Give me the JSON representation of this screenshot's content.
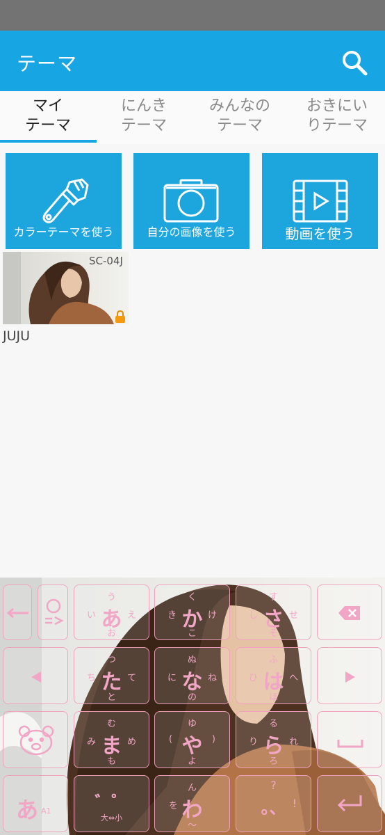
{
  "app_bar": {
    "title": "テーマ"
  },
  "tabs": [
    {
      "line1": "マイ",
      "line2": "テーマ",
      "active": true
    },
    {
      "line1": "にんき",
      "line2": "テーマ",
      "active": false
    },
    {
      "line1": "みんなの",
      "line2": "テーマ",
      "active": false
    },
    {
      "line1": "おきにい",
      "line2": "りテーマ",
      "active": false
    }
  ],
  "tiles": {
    "color_theme": "カラーテーマを使う",
    "own_image": "自分の画像を使う",
    "video": "動画を使う"
  },
  "theme_item": {
    "device": "SC-04J",
    "name": "JUJU"
  },
  "keyboard": {
    "row1": {
      "a": {
        "main": "あ",
        "up": "う",
        "left": "い",
        "right": "え",
        "down": "お"
      },
      "ka": {
        "main": "か",
        "up": "く",
        "left": "き",
        "right": "け",
        "down": "こ"
      },
      "sa": {
        "main": "さ",
        "up": "す",
        "left": "し",
        "right": "せ",
        "down": "そ"
      }
    },
    "row2": {
      "ta": {
        "main": "た",
        "up": "つ",
        "left": "ち",
        "right": "て",
        "down": "と"
      },
      "na": {
        "main": "な",
        "up": "ぬ",
        "left": "に",
        "right": "ね",
        "down": "の"
      },
      "ha": {
        "main": "は",
        "up": "ふ",
        "left": "ひ",
        "right": "へ",
        "down": "ほ"
      }
    },
    "row3": {
      "ma": {
        "main": "ま",
        "up": "む",
        "left": "み",
        "right": "め",
        "down": "も"
      },
      "ya": {
        "main": "や",
        "up": "ゆ",
        "left": "(",
        "right": ")",
        "down": "よ"
      },
      "ra": {
        "main": "ら",
        "up": "る",
        "left": "り",
        "right": "れ",
        "down": "ろ"
      }
    },
    "row4": {
      "mode": {
        "main": "あ",
        "sub": "A1"
      },
      "dakuten": {
        "main": "゛゜",
        "sub": "大⇔小"
      },
      "wa": {
        "main": "わ",
        "up": "ん",
        "left": "を",
        "down": "〜"
      },
      "punct": {
        "main": "。、",
        "up": "?",
        "right": "!"
      }
    },
    "enter": "↵",
    "space": "␣"
  },
  "colors": {
    "accent": "#17a5e3",
    "tile": "#1da6dd",
    "kana": "#f2a6c6"
  }
}
